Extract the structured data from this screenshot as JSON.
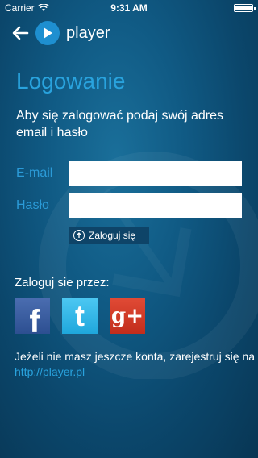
{
  "status_bar": {
    "carrier": "Carrier",
    "time": "9:31 AM"
  },
  "nav": {
    "back_icon": "arrow-left-icon",
    "logo_icon": "play-icon",
    "logo_text": "player"
  },
  "login": {
    "title": "Logowanie",
    "subtitle": "Aby się zalogować podaj swój adres email i hasło",
    "email_label": "E-mail",
    "email_value": "",
    "password_label": "Hasło",
    "password_value": "",
    "submit_label": "Zaloguj się",
    "submit_icon": "login-arrow-icon"
  },
  "social": {
    "label": "Zaloguj sie przez:",
    "providers": [
      {
        "name": "facebook",
        "glyph": "f",
        "color": "#3b5998"
      },
      {
        "name": "twitter",
        "glyph": "t",
        "color": "#2bb5e8"
      },
      {
        "name": "google-plus",
        "glyph": "g+",
        "color": "#d23f2d"
      }
    ]
  },
  "footer": {
    "text": "Jeżeli nie masz jeszcze konta, zarejestruj się na",
    "link": "http://player.pl"
  },
  "colors": {
    "accent": "#29a3de",
    "background": "#0b476c"
  }
}
